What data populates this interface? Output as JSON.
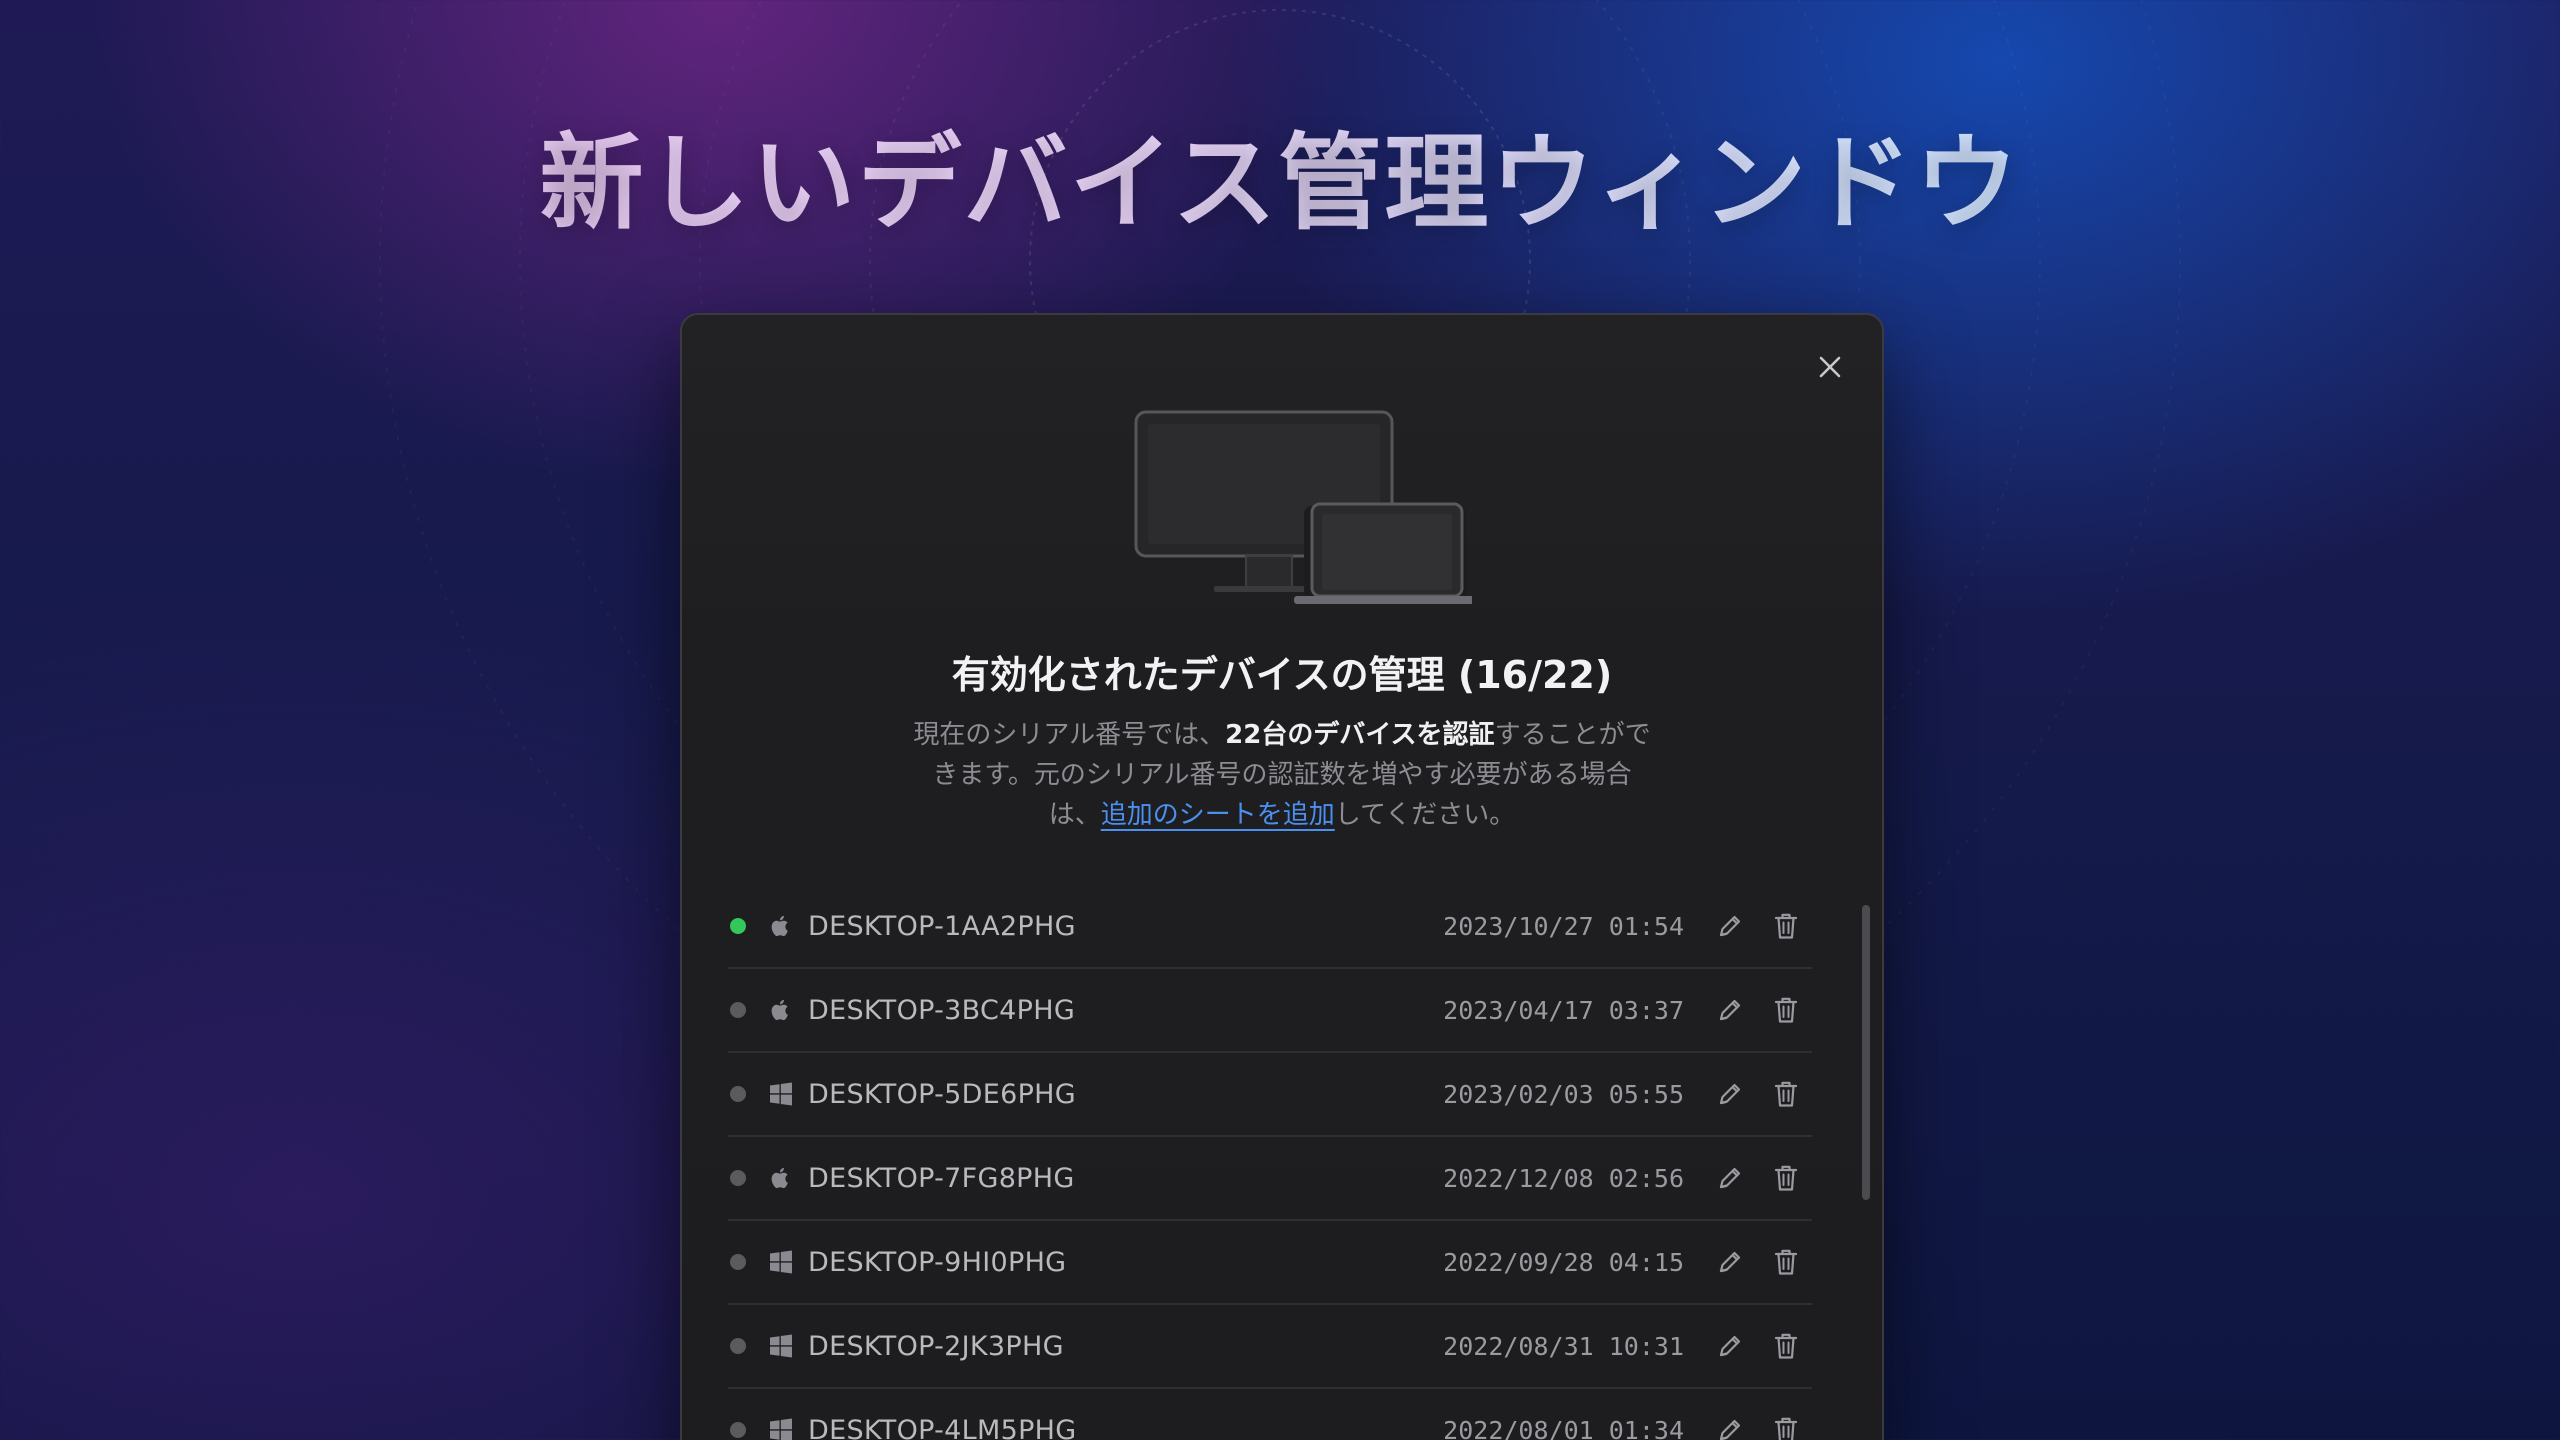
{
  "hero": {
    "title": "新しいデバイス管理ウィンドウ"
  },
  "dialog": {
    "title": "有効化されたデバイスの管理 (16/22)",
    "description": {
      "part1": "現在のシリアル番号では、",
      "strong": "22台のデバイスを認証",
      "part2": "することができます。元のシリアル番号の認証数を増やす必要がある場合は、",
      "link": "追加のシートを追加",
      "part3": "してください。"
    },
    "close_icon": "close-icon",
    "illustration": "devices-illustration",
    "devices": [
      {
        "name": "DESKTOP-1AA2PHG",
        "date": "2023/10/27 01:54",
        "os": "apple",
        "online": true
      },
      {
        "name": "DESKTOP-3BC4PHG",
        "date": "2023/04/17 03:37",
        "os": "apple",
        "online": false
      },
      {
        "name": "DESKTOP-5DE6PHG",
        "date": "2023/02/03 05:55",
        "os": "windows",
        "online": false
      },
      {
        "name": "DESKTOP-7FG8PHG",
        "date": "2022/12/08 02:56",
        "os": "apple",
        "online": false
      },
      {
        "name": "DESKTOP-9HI0PHG",
        "date": "2022/09/28 04:15",
        "os": "windows",
        "online": false
      },
      {
        "name": "DESKTOP-2JK3PHG",
        "date": "2022/08/31 10:31",
        "os": "windows",
        "online": false
      },
      {
        "name": "DESKTOP-4LM5PHG",
        "date": "2022/08/01 01:34",
        "os": "windows",
        "online": false
      }
    ]
  },
  "colors": {
    "online": "#34c759",
    "offline": "#5a5a5f",
    "link": "#4b8ff0",
    "dialog_bg": "#1e1e20"
  }
}
